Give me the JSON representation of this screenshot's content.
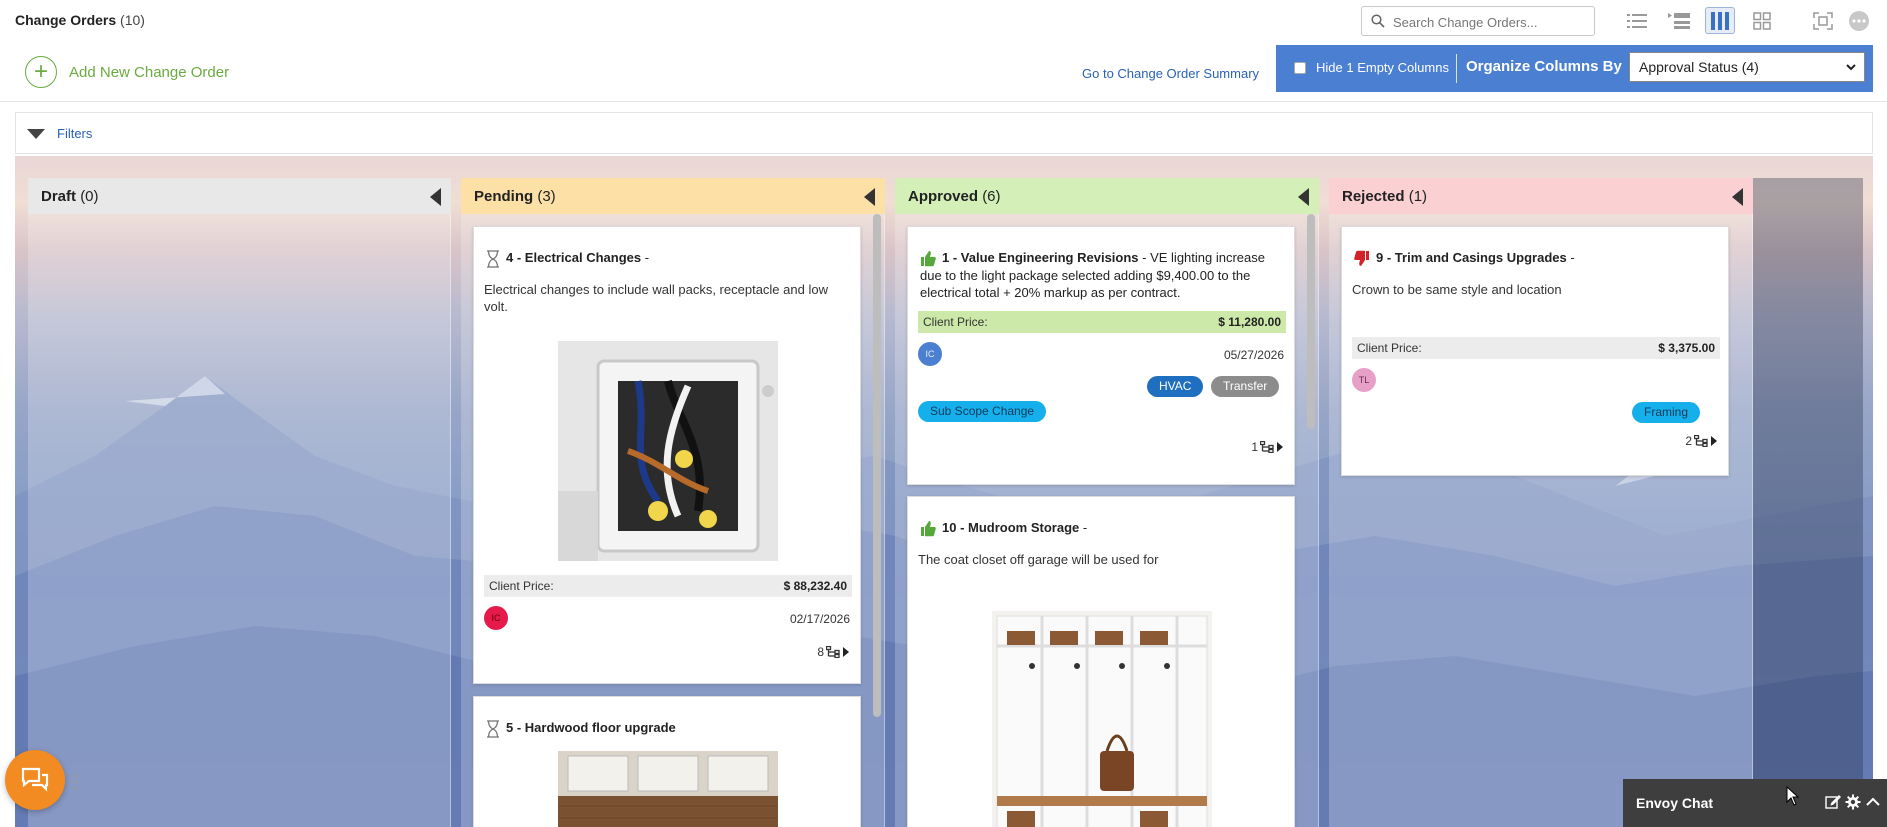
{
  "header": {
    "title": "Change Orders",
    "count": "(10)",
    "search_placeholder": "Search Change Orders...",
    "views": [
      "list-view",
      "compact-list-view",
      "board-view",
      "grid-view",
      "fullscreen",
      "more"
    ]
  },
  "toolbar": {
    "add_label": "Add New Change Order",
    "summary_link": "Go to Change Order Summary",
    "hide_empty_label": "Hide 1 Empty Columns",
    "organize_label": "Organize Columns By",
    "organize_value": "Approval Status (4)"
  },
  "filters": {
    "label": "Filters"
  },
  "columns": [
    {
      "name": "Draft",
      "count": "(0)",
      "color": "#e8e8e8"
    },
    {
      "name": "Pending",
      "count": "(3)",
      "color": "#fde0a6"
    },
    {
      "name": "Approved",
      "count": "(6)",
      "color": "#d4efb8"
    },
    {
      "name": "Rejected",
      "count": "(1)",
      "color": "#fbd0d2"
    }
  ],
  "cards": {
    "pending_1": {
      "number": "4",
      "title": "Electrical Changes",
      "sep": " -",
      "desc": "Electrical changes to include wall packs, receptacle and low volt.",
      "price_label": "Client Price:",
      "price": "$ 88,232.40",
      "avatar": "IC",
      "date": "02/17/2026",
      "links": "8"
    },
    "pending_2": {
      "number": "5",
      "title": "Hardwood floor upgrade"
    },
    "approved_1": {
      "number": "1",
      "title": "Value Engineering Revisions",
      "sep": " - ",
      "desc_inline": "VE lighting increase due to the light package selected adding $9,400.00 to the electrical total + 20% markup as per contract.",
      "price_label": "Client Price:",
      "price": "$ 11,280.00",
      "avatar": "IC",
      "date": "05/27/2026",
      "tags": [
        "HVAC",
        "Transfer",
        "Sub Scope Change"
      ],
      "links": "1"
    },
    "approved_2": {
      "number": "10",
      "title": "Mudroom Storage",
      "sep": " -",
      "desc": "The coat closet off garage will be used for"
    },
    "rejected_1": {
      "number": "9",
      "title": "Trim and Casings Upgrades",
      "sep": " -",
      "desc": "Crown to be same style and location",
      "price_label": "Client Price:",
      "price": "$ 3,375.00",
      "avatar": "TL",
      "tags": [
        "Framing"
      ],
      "links": "2"
    }
  },
  "chat": {
    "label": "Envoy Chat"
  },
  "colors": {
    "accent": "#4a7fd2",
    "add_green": "#6aab3f",
    "link_blue": "#2a62b5",
    "tag_blue": "#1e6fc0",
    "tag_gray": "#8c8c8c",
    "tag_cyan": "#15b0ec",
    "price_green": "#cde9a9",
    "price_gray": "#ececec"
  }
}
